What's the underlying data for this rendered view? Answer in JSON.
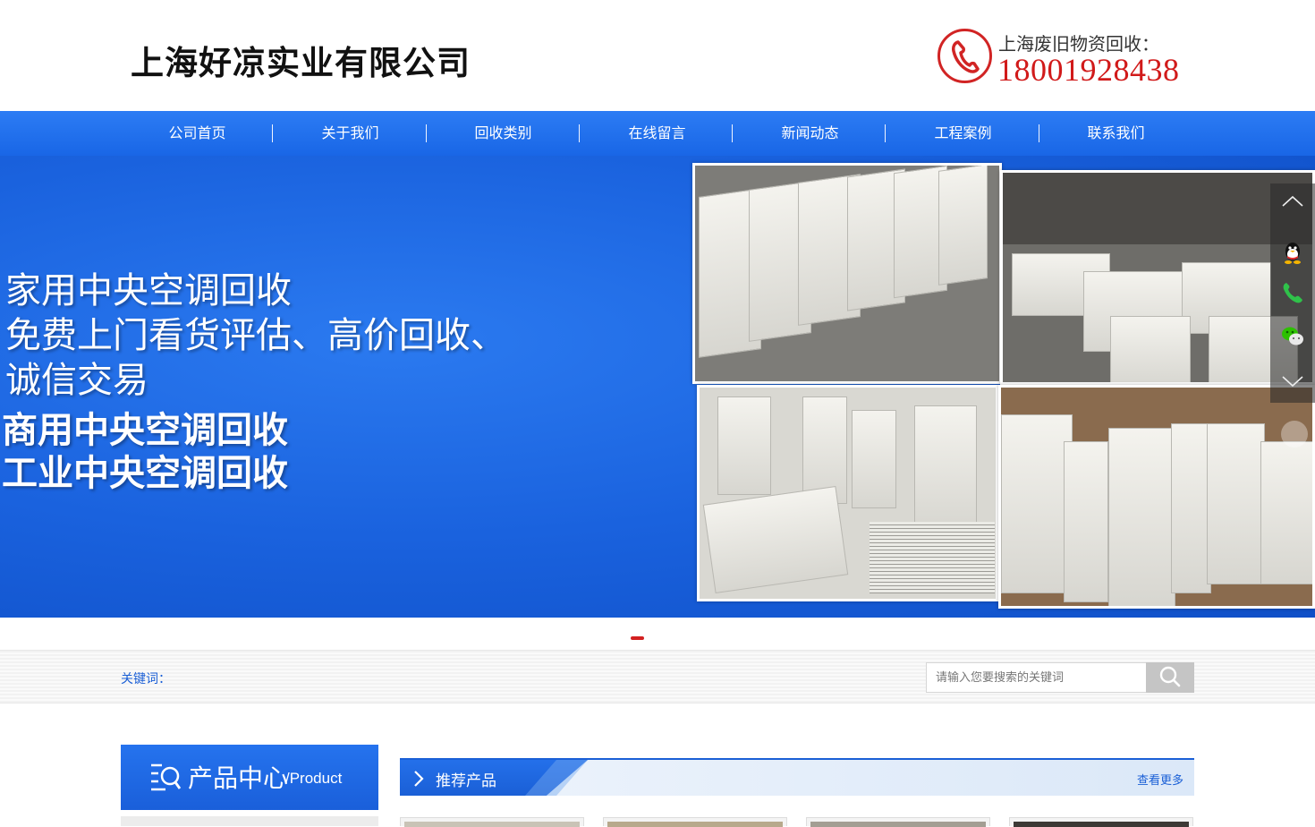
{
  "header": {
    "company_name": "上海好凉实业有限公司",
    "hotline_label": "上海废旧物资回收：",
    "hotline_number": "18001928438",
    "phone_icon": "phone-circle-icon"
  },
  "nav": {
    "items": [
      {
        "label": "公司首页"
      },
      {
        "label": "关于我们"
      },
      {
        "label": "回收类别"
      },
      {
        "label": "在线留言"
      },
      {
        "label": "新闻动态"
      },
      {
        "label": "工程案例"
      },
      {
        "label": "联系我们"
      }
    ]
  },
  "banner": {
    "lines": [
      "家用中央空调回收",
      "免费上门看货评估、高价回收、",
      "诚信交易",
      "商用中央空调回收",
      "工业中央空调回收"
    ]
  },
  "sidebar": {
    "icons": [
      "chevron-up-icon",
      "qq-icon",
      "phone-icon",
      "wechat-icon",
      "chevron-down-icon"
    ]
  },
  "search": {
    "keyword_label": "关键词：",
    "placeholder": "请输入您要搜索的关键词",
    "button_icon": "search-icon"
  },
  "products": {
    "title": "产品中心",
    "subtitle": "/Product",
    "recommended_title": "推荐产品",
    "more_link": "查看更多"
  },
  "colors": {
    "brand_blue": "#1a62de",
    "accent_red": "#d11a1a"
  }
}
